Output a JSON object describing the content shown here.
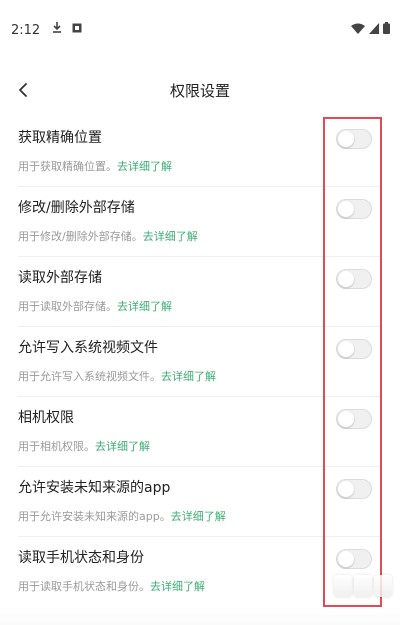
{
  "status_bar": {
    "time": "2:12",
    "icons_left": [
      "download-icon",
      "square-notification-icon"
    ],
    "icons_right": [
      "wifi-icon",
      "signal-icon",
      "battery-icon"
    ]
  },
  "header": {
    "title": "权限设置",
    "back_icon": "back-arrow-icon"
  },
  "permissions": [
    {
      "title": "获取精确位置",
      "desc": "用于获取精确位置。",
      "link": "去详细了解",
      "enabled": false
    },
    {
      "title": "修改/删除外部存储",
      "desc": "用于修改/删除外部存储。",
      "link": "去详细了解",
      "enabled": false
    },
    {
      "title": "读取外部存储",
      "desc": "用于读取外部存储。",
      "link": "去详细了解",
      "enabled": false
    },
    {
      "title": "允许写入系统视频文件",
      "desc": "用于允许写入系统视频文件。",
      "link": "去详细了解",
      "enabled": false
    },
    {
      "title": "相机权限",
      "desc": "用于相机权限。",
      "link": "去详细了解",
      "enabled": false
    },
    {
      "title": "允许安装未知来源的app",
      "desc": "用于允许安装未知来源的app。",
      "link": "去详细了解",
      "enabled": false
    },
    {
      "title": "读取手机状态和身份",
      "desc": "用于读取手机状态和身份。",
      "link": "去详细了解",
      "enabled": false
    }
  ],
  "colors": {
    "link": "#3cae74",
    "highlight": "#e24a55",
    "toggle_off": "#f0f0f0"
  }
}
